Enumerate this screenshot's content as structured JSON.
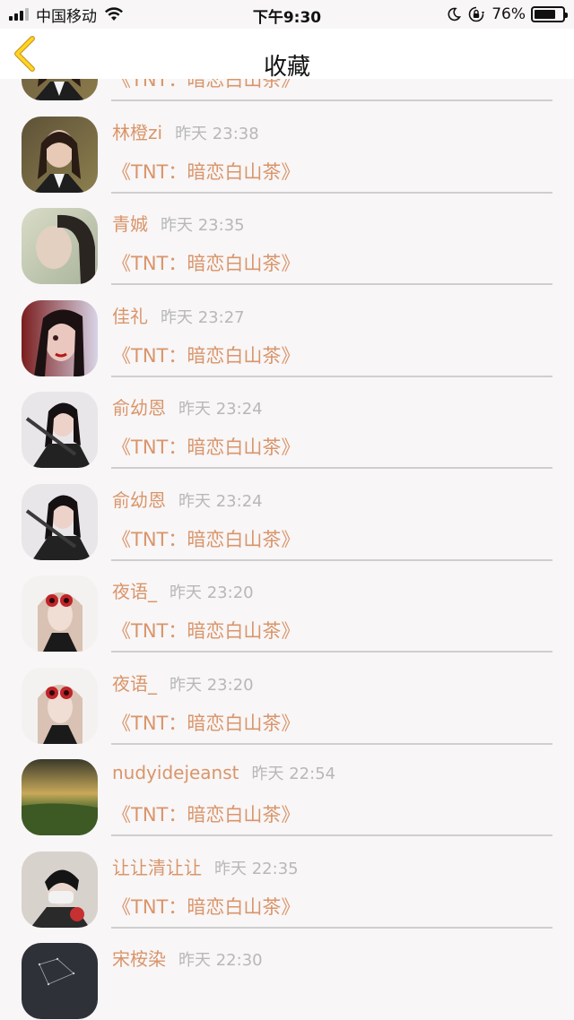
{
  "status_bar": {
    "carrier": "中国移动",
    "time": "下午9:30",
    "battery_percent": "76%",
    "battery_level": 0.76
  },
  "nav": {
    "title": "收藏",
    "accent_color": "#e8a500"
  },
  "colors": {
    "name_color": "#d9956a",
    "time_color": "#b8b8b8",
    "divider": "#cfcfcf"
  },
  "items": [
    {
      "name": "",
      "time": "",
      "book": "《TNT：暗恋白山茶》"
    },
    {
      "name": "林橙zi",
      "time": "昨天 23:38",
      "book": "《TNT：暗恋白山茶》"
    },
    {
      "name": "青娍",
      "time": "昨天 23:35",
      "book": "《TNT：暗恋白山茶》"
    },
    {
      "name": "佳礼",
      "time": "昨天 23:27",
      "book": "《TNT：暗恋白山茶》"
    },
    {
      "name": "俞幼恩",
      "time": "昨天 23:24",
      "book": "《TNT：暗恋白山茶》"
    },
    {
      "name": "俞幼恩",
      "time": "昨天 23:24",
      "book": "《TNT：暗恋白山茶》"
    },
    {
      "name": "夜语_",
      "time": "昨天 23:20",
      "book": "《TNT：暗恋白山茶》"
    },
    {
      "name": "夜语_",
      "time": "昨天 23:20",
      "book": "《TNT：暗恋白山茶》"
    },
    {
      "name": "nudyidejeanst",
      "time": "昨天 22:54",
      "book": "《TNT：暗恋白山茶》"
    },
    {
      "name": "让让清让让",
      "time": "昨天 22:35",
      "book": "《TNT：暗恋白山茶》"
    },
    {
      "name": "宋桉染",
      "time": "昨天 22:30",
      "book": ""
    }
  ]
}
